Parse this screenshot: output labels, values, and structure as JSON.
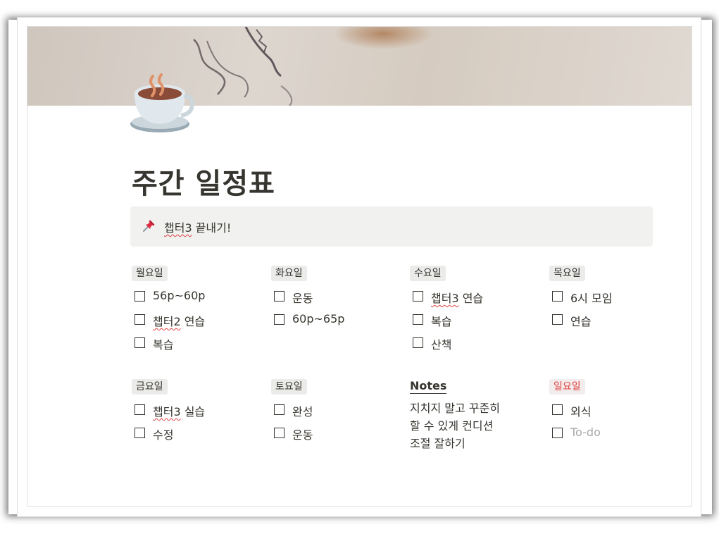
{
  "page": {
    "title": "주간 일정표",
    "icon": "hot-beverage-icon"
  },
  "callout": {
    "icon": "pushpin-icon",
    "text_spell": "챕터3",
    "text_rest": " 끝내기!"
  },
  "days": {
    "mon": {
      "label": "월요일",
      "items": [
        {
          "text": "56p~60p",
          "checked": false
        },
        {
          "spell": "챕터2",
          "rest": " 연습",
          "checked": false
        },
        {
          "text": "복습",
          "checked": false
        }
      ]
    },
    "tue": {
      "label": "화요일",
      "items": [
        {
          "text": "운동",
          "checked": false
        },
        {
          "text": "60p~65p",
          "checked": false
        }
      ]
    },
    "wed": {
      "label": "수요일",
      "items": [
        {
          "spell": "챕터3",
          "rest": " 연습",
          "checked": false
        },
        {
          "text": "복습",
          "checked": false
        },
        {
          "text": "산책",
          "checked": false
        }
      ]
    },
    "thu": {
      "label": "목요일",
      "items": [
        {
          "text": "6시 모임",
          "checked": false
        },
        {
          "text": "연습",
          "checked": false
        }
      ]
    },
    "fri": {
      "label": "금요일",
      "items": [
        {
          "spell": "챕터3",
          "rest": " 실습",
          "checked": false
        },
        {
          "text": "수정",
          "checked": false
        }
      ]
    },
    "sat": {
      "label": "토요일",
      "items": [
        {
          "text": "완성",
          "checked": false
        },
        {
          "text": "운동",
          "checked": false
        }
      ]
    },
    "sun": {
      "label": "일요일",
      "label_color": "#e03e3e",
      "items": [
        {
          "text": "외식",
          "checked": false
        },
        {
          "placeholder": "To-do",
          "checked": false
        }
      ]
    }
  },
  "notes": {
    "heading": "Notes",
    "lines": [
      "지치지 말고 꾸준히",
      "할 수 있게 컨디션",
      "조절 잘하기"
    ]
  }
}
